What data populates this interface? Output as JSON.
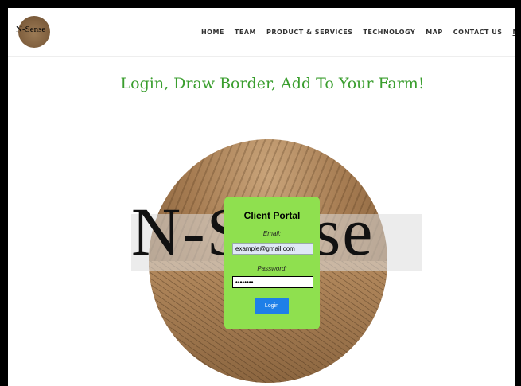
{
  "brand": {
    "logo_text": "N-Sense"
  },
  "nav": {
    "items": [
      "HOME",
      "TEAM",
      "PRODUCT & SERVICES",
      "TECHNOLOGY",
      "MAP",
      "CONTACT US",
      "M"
    ]
  },
  "headline": "Login, Draw Border, Add To Your Farm!",
  "hero": {
    "overlay_text": "N-Sense"
  },
  "login": {
    "title": "Client Portal",
    "email_label": "Email:",
    "email_value": "example@gmail.com",
    "password_label": "Password:",
    "password_value": "••••••••",
    "button_label": "Login"
  },
  "colors": {
    "headline": "#3a9e2e",
    "card": "#8fe04f",
    "button": "#1e7fe8"
  }
}
